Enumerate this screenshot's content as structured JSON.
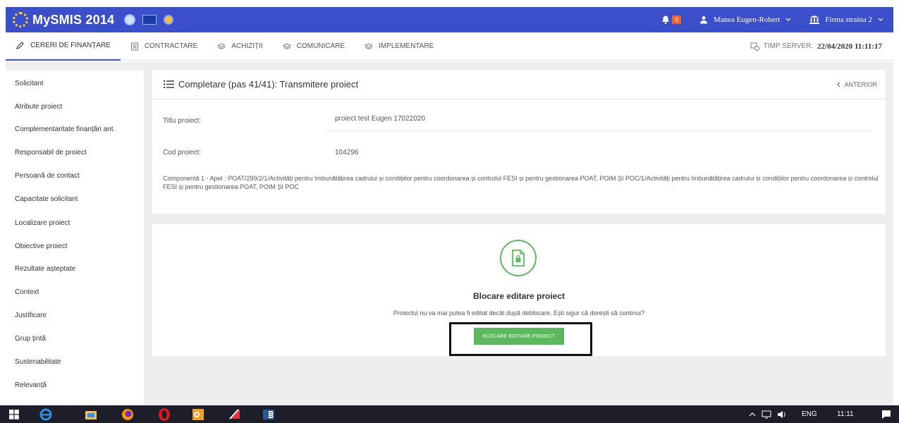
{
  "app": {
    "title": "MySMIS 2014"
  },
  "header": {
    "notifications_count": "0",
    "user_name": "Manea Eugen-Robert",
    "firm_name": "Firma straina 2"
  },
  "nav": {
    "tabs": [
      {
        "label": "CERERI DE FINANȚARE",
        "icon": "pencil-icon",
        "active": true
      },
      {
        "label": "CONTRACTARE",
        "icon": "document-icon",
        "active": false
      },
      {
        "label": "ACHIZIȚII",
        "icon": "layers-icon",
        "active": false
      },
      {
        "label": "COMUNICARE",
        "icon": "layers-icon",
        "active": false
      },
      {
        "label": "IMPLEMENTARE",
        "icon": "layers-icon",
        "active": false
      }
    ],
    "server_label": "TIMP SERVER:",
    "server_time": "22/04/2020  11:11:17"
  },
  "sidebar": {
    "items": [
      "Solicitant",
      "Atribute proiect",
      "Complementaritate finanțări ant.",
      "Responsabil de proiect",
      "Persoană de contact",
      "Capacitate solicitant",
      "Localizare proiect",
      "Obiective proiect",
      "Rezultate așteptate",
      "Context",
      "Justificare",
      "Grup țintă",
      "Sustenabilitate",
      "Relevanță"
    ]
  },
  "main": {
    "title": "Completare (pas 41/41): Transmitere proiect",
    "prev_label": "ANTERIOR",
    "fields": [
      {
        "label": "Titlu proiect:",
        "value": "proiect test Eugen 17022020"
      },
      {
        "label": "Cod proiect:",
        "value": "104296"
      }
    ],
    "component_text": "Componentă 1 - Apel : POAT/299/2/1/Activități pentru îmbunătățirea cadrului și condițiilor pentru coordonarea și controlul FESI și pentru gestionarea POAT, POIM ȘI POC/1/Activități pentru îmbunătățirea cadrului și condițiilor pentru coordonarea și controlul FESI și pentru gestionarea POAT, POIM ȘI POC"
  },
  "lock_panel": {
    "icon": "lock-file-icon",
    "title": "Blocare editare proiect",
    "description": "Proiectul nu va mai putea fi editat decât după deblocare. Ești sigur că dorești să continui?",
    "button_label": "BLOCARE EDITARE PROIECT"
  },
  "taskbar": {
    "language": "ENG",
    "clock": "11:11"
  },
  "colors": {
    "header_bg": "#3a4fc9",
    "accent_green": "#5cb85c",
    "badge_orange": "#e8632d"
  }
}
